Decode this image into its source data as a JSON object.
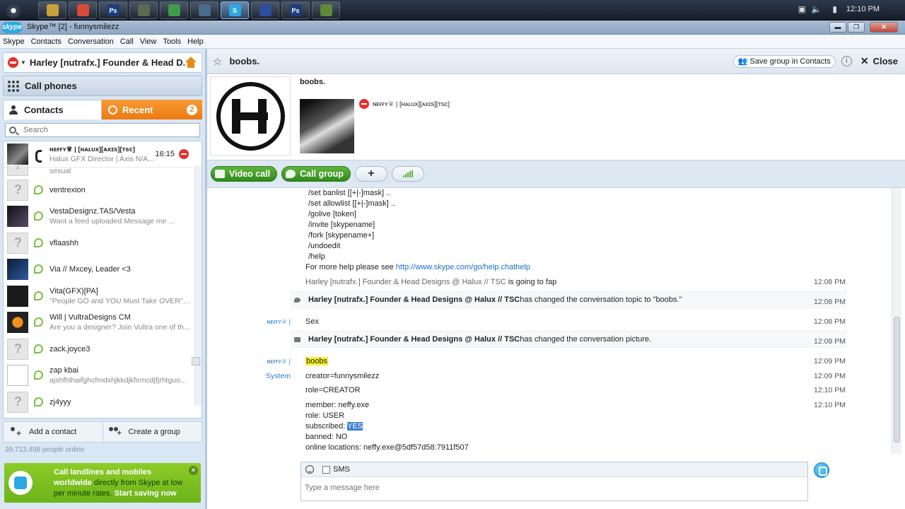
{
  "taskbar": {
    "apps": [
      {
        "name": "explorer",
        "color": "#c8a13a",
        "glyph": ""
      },
      {
        "name": "chrome",
        "color": "#d94a38",
        "glyph": ""
      },
      {
        "name": "photoshop",
        "color": "#1b3e7a",
        "glyph": "Ps"
      },
      {
        "name": "game",
        "color": "#5a6b52",
        "glyph": ""
      },
      {
        "name": "drive",
        "color": "#3f9b4b",
        "glyph": ""
      },
      {
        "name": "editor",
        "color": "#4b6b8c",
        "glyph": ""
      },
      {
        "name": "skype",
        "color": "#2aa8e4",
        "glyph": "S",
        "active": true
      },
      {
        "name": "firefox",
        "color": "#2f4d9e",
        "glyph": ""
      },
      {
        "name": "photoshop2",
        "color": "#1b3e7a",
        "glyph": "Ps"
      },
      {
        "name": "minecraft",
        "color": "#5e8a3a",
        "glyph": ""
      }
    ],
    "clock": "12:10 PM"
  },
  "window": {
    "logo": "skype",
    "title": "Skype™ [2] - funnysmilezz",
    "min": "▬",
    "max": "❐",
    "close": "✕"
  },
  "menu": [
    "Skype",
    "Contacts",
    "Conversation",
    "Call",
    "View",
    "Tools",
    "Help"
  ],
  "profile": {
    "name": "Harley [nutrafx.] Founder & Head D..."
  },
  "call_phones": "Call phones",
  "tabs": {
    "contacts": "Contacts",
    "recent": "Recent",
    "recent_badge": "2"
  },
  "search": {
    "placeholder": "Search"
  },
  "contacts": [
    {
      "name": "ɴᴇғғʏ♕ | [ʜᴀʟᴜx][ᴀxɪs][ᴛsᴄ]",
      "mood": "Halux GFX Director | Axis N/A Co-leader / Re...",
      "time": "16:15",
      "avatar": "pic"
    },
    {
      "name": "",
      "mood": "sexual",
      "avatar": "q"
    },
    {
      "name": "ventrexion",
      "mood": "",
      "avatar": "q"
    },
    {
      "name": "VestaDesignz.TAS/Vesta",
      "mood": "Want a feed uploaded Message me ...",
      "avatar": "dark"
    },
    {
      "name": "vflaashh",
      "mood": "",
      "avatar": "q"
    },
    {
      "name": "Via // Mxcey, Leader <3",
      "mood": "",
      "avatar": "blue"
    },
    {
      "name": "Vita(GFX)[PA]",
      "mood": "\"People GO and YOU Must Take OVER\" -V...",
      "avatar": "black"
    },
    {
      "name": "Will | VultraDesigns CM",
      "mood": "Are you a designer? Join Vultra one of th...",
      "avatar": "orange"
    },
    {
      "name": "zack.joyce3",
      "mood": "",
      "avatar": "q"
    },
    {
      "name": "zap kbai",
      "mood": "ajshfhlhaifghcfmdxhjkkdjkfirmcdjfjrhtguo...",
      "avatar": "face"
    },
    {
      "name": "zj4yyy",
      "mood": "",
      "avatar": "q"
    }
  ],
  "left_actions": {
    "add_contact": "Add a contact",
    "create_group": "Create a group"
  },
  "online_count": "39,713,498 people online",
  "ad": {
    "bold1": "Call landlines and mobiles",
    "bold2": "worldwide",
    "text": " directly from Skype at low per minute rates. ",
    "cta": "Start saving now"
  },
  "conversation": {
    "title": "boobs.",
    "save_group": "Save group in Contacts",
    "close": "Close",
    "topic": "boobs.",
    "member_name": "ɴᴇғғʏ♕ | [ʜᴀʟᴜx][ᴀxɪs][ᴛsᴄ]"
  },
  "actions": {
    "video_call": "Video call",
    "call_group": "Call group",
    "add": "+"
  },
  "chat": {
    "help_lines": [
      "/set banlist [[+|-]mask] ..",
      "/set allowlist [[+|-]mask] ..",
      "/golive [token]",
      "/invite [skypename]",
      "/fork [skypename+]",
      "/undoedit",
      "/help"
    ],
    "more_help_prefix": "For more help please see ",
    "more_help_link": "http://www.skype.com/go/help.chathelp",
    "fap_who": "Harley [nutrafx.] Founder & Head Designs @ Halux // TSC",
    "fap_action": " is going to fap",
    "fap_time": "12:08 PM",
    "topic_who": "Harley [nutrafx.] Founder & Head Designs @ Halux // TSC",
    "topic_action": " has changed the conversation topic to \"boobs.\"",
    "topic_time": "12:08 PM",
    "sex_sender": "ɴᴇғғʏ♕ |",
    "sex_text": "Sex",
    "sex_time": "12:08 PM",
    "pic_who": "Harley [nutrafx.] Founder & Head Designs @ Halux // TSC",
    "pic_action": " has changed the conversation picture.",
    "pic_time": "12:09 PM",
    "boobs_sender": "ɴᴇғғʏ♕ |",
    "boobs_text": "boobs",
    "boobs_time": "12:09 PM",
    "system_sender": "System",
    "creator": "creator=funnysmilezz",
    "creator_time": "12:09 PM",
    "role": "role=CREATOR",
    "role_time": "12:10 PM",
    "member": "member: neffy.exe",
    "member_time": "12:10 PM",
    "role_user": "role: USER",
    "subscribed_prefix": "subscribed: ",
    "subscribed_value": "YES",
    "banned": "banned: NO",
    "locations": "online locations: neffy.exe@5df57d58:7911f507"
  },
  "compose": {
    "sms": "SMS",
    "placeholder": "Type a message here"
  },
  "colors": {
    "accent_orange": "#ed7a10",
    "skype_blue": "#2aa8e4",
    "green": "#3c9a28",
    "link": "#1a6fc5"
  }
}
